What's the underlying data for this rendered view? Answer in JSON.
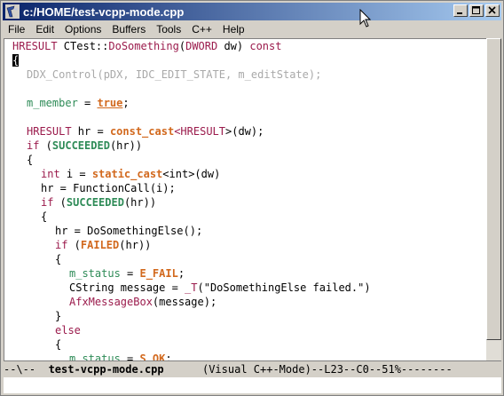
{
  "window": {
    "title": "c:/HOME/test-vcpp-mode.cpp"
  },
  "menu": {
    "items": [
      "File",
      "Edit",
      "Options",
      "Buffers",
      "Tools",
      "C++",
      "Help"
    ]
  },
  "code": {
    "l1": {
      "a": "HRESULT",
      "b": " CTest::",
      "c": "DoSomething",
      "d": "(",
      "e": "DWORD",
      "f": " dw) ",
      "g": "const"
    },
    "l2": {
      "cursor": "{"
    },
    "l3": {
      "a": "DDX_Control(pDX, IDC_EDIT_STATE, m_editState);"
    },
    "l4": {
      "a": "m_member",
      "b": " = ",
      "c": "true",
      "d": ";"
    },
    "l5": {
      "a": "HRESULT",
      "b": " hr = ",
      "c": "const_cast",
      "d": "<",
      "e": "HRESULT",
      "f": ">(dw);"
    },
    "l6": {
      "a": "if",
      "b": " (",
      "c": "SUCCEEDED",
      "d": "(hr))"
    },
    "l7": {
      "a": "{"
    },
    "l8": {
      "a": "int",
      "b": " i = ",
      "c": "static_cast",
      "d": "<int>(dw)"
    },
    "l9": {
      "a": "hr = FunctionCall(i);"
    },
    "l10": {
      "a": "if",
      "b": " (",
      "c": "SUCCEEDED",
      "d": "(hr))"
    },
    "l11": {
      "a": "{"
    },
    "l12": {
      "a": "hr = DoSomethingElse();"
    },
    "l13": {
      "a": "if",
      "b": " (",
      "c": "FAILED",
      "d": "(hr))"
    },
    "l14": {
      "a": "{"
    },
    "l15": {
      "a": "m_status",
      "b": " = ",
      "c": "E_FAIL",
      "d": ";"
    },
    "l16": {
      "a": "CString message = ",
      "b": "_T",
      "c": "(\"DoSomethingElse failed.\")"
    },
    "l17": {
      "a": "AfxMessageBox",
      "b": "(message);"
    },
    "l18": {
      "a": "}"
    },
    "l19": {
      "a": "else"
    },
    "l20": {
      "a": "{"
    },
    "l21": {
      "a": "m_status",
      "b": " = ",
      "c": "S_OK",
      "d": ";"
    },
    "l22": {
      "a": "}"
    }
  },
  "modeline": {
    "prefix": "--\\--  ",
    "buffer": "test-vcpp-mode.cpp",
    "suffix": "      (Visual C++-Mode)--L23--C0--51%--------"
  },
  "colors": {
    "titlebar_start": "#0a246a",
    "titlebar_end": "#a6caf0",
    "type": "#9b1b4c",
    "keyword": "#1b6b7a",
    "cast": "#d2691e",
    "macro": "#2e8b57"
  }
}
